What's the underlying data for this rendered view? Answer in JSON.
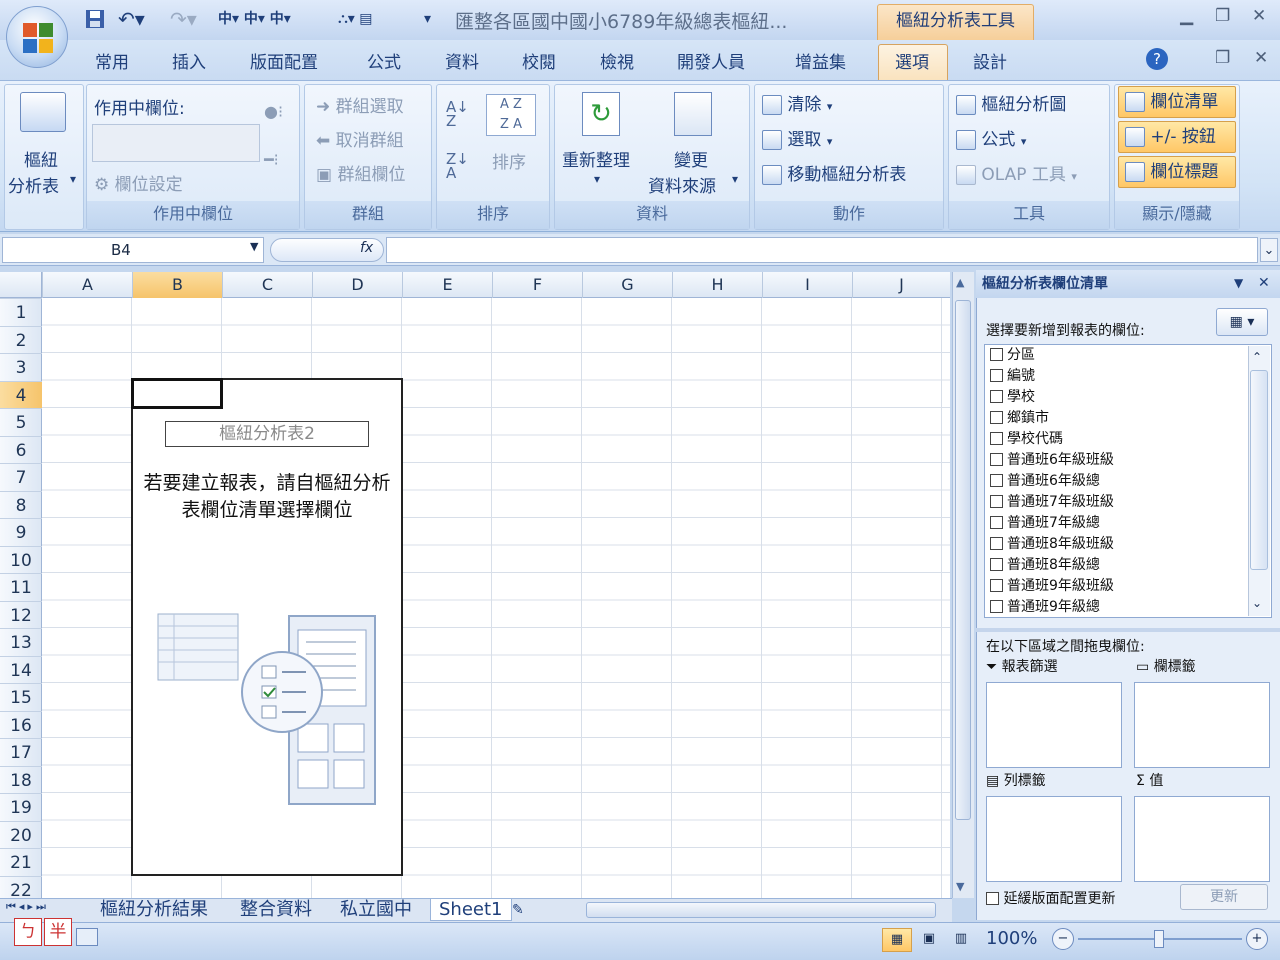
{
  "title_bar": {
    "window_title": "匯整各區國中國小6789年級總表樞紐...",
    "context_tab": "樞紐分析表工具",
    "qat_icons": [
      "save-icon",
      "undo-icon",
      "redo-icon"
    ]
  },
  "tabs": [
    "常用",
    "插入",
    "版面配置",
    "公式",
    "資料",
    "校閱",
    "檢視",
    "開發人員",
    "增益集",
    "選項",
    "設計"
  ],
  "ribbon": {
    "pivot_btn_line1": "樞紐",
    "pivot_btn_line2": "分析表",
    "active_field_label": "作用中欄位:",
    "field_settings": "欄位設定",
    "group_active_field": "作用中欄位",
    "group_selection": "群組選取",
    "ungroup": "取消群組",
    "group_field": "群組欄位",
    "group_group": "群組",
    "sort_label": "排序",
    "group_sort": "排序",
    "refresh": "重新整理",
    "change_1": "變更",
    "change_2": "資料來源",
    "group_data": "資料",
    "clear": "清除",
    "select": "選取",
    "move_pivot": "移動樞紐分析表",
    "group_actions": "動作",
    "pivot_chart": "樞紐分析圖",
    "formulas": "公式",
    "olap": "OLAP 工具",
    "group_tools": "工具",
    "field_list": "欄位清單",
    "buttons": "+/- 按鈕",
    "field_headers": "欄位標題",
    "group_show_hide": "顯示/隱藏"
  },
  "formula_bar": {
    "name_box": "B4",
    "fx": "fx",
    "formula": ""
  },
  "columns": [
    "A",
    "B",
    "C",
    "D",
    "E",
    "F",
    "G",
    "H",
    "I",
    "J"
  ],
  "rows": [
    "1",
    "2",
    "3",
    "4",
    "5",
    "6",
    "7",
    "8",
    "9",
    "10",
    "11",
    "12",
    "13",
    "14",
    "15",
    "16",
    "17",
    "18",
    "19",
    "20",
    "21",
    "22"
  ],
  "pivot_placeholder": {
    "name": "樞紐分析表2",
    "message_line1": "若要建立報表，請自樞紐分析",
    "message_line2": "表欄位清單選擇欄位"
  },
  "task_pane": {
    "title": "樞紐分析表欄位清單",
    "choose_label": "選擇要新增到報表的欄位:",
    "fields": [
      "分區",
      "編號",
      "學校",
      "鄉鎮市",
      "學校代碼",
      "普通班6年級班級",
      "普通班6年級總",
      "普通班7年級班級",
      "普通班7年級總",
      "普通班8年級班級",
      "普通班8年級總",
      "普通班9年級班級",
      "普通班9年級總"
    ],
    "drag_label": "在以下區域之間拖曳欄位:",
    "report_filter": "報表篩選",
    "column_labels": "欄標籤",
    "row_labels": "列標籤",
    "values": "值",
    "defer_update": "延緩版面配置更新",
    "update_button": "更新"
  },
  "sheet_tabs": [
    "樞紐分析結果",
    "整合資料",
    "私立國中",
    "Sheet1"
  ],
  "status_bar": {
    "zoom": "100%",
    "ime_1": "ㄅ",
    "ime_2": "半"
  }
}
